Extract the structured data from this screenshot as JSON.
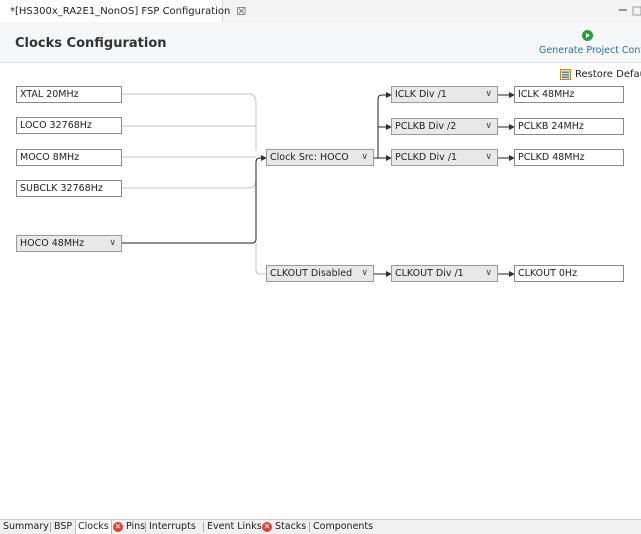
{
  "editor_tab": {
    "title": "*[HS300x_RA2E1_NonOS] FSP Configuration",
    "close": "☒"
  },
  "header": {
    "title": "Clocks Configuration",
    "generate_label": "Generate Project Content"
  },
  "toolbar": {
    "restore_label": "Restore Defaults"
  },
  "clock_sources": {
    "xtal": "XTAL 20MHz",
    "loco": "LOCO 32768Hz",
    "moco": "MOCO 8MHz",
    "subclk": "SUBCLK 32768Hz",
    "hoco": "HOCO 48MHz"
  },
  "clock_src_select": "Clock Src: HOCO",
  "dividers": {
    "iclk": "ICLK Div /1",
    "pclkb": "PCLKB Div /2",
    "pclkd": "PCLKD Div /1",
    "clkout_src": "CLKOUT Disabled",
    "clkout_div": "CLKOUT Div /1"
  },
  "outputs": {
    "iclk": "ICLK 48MHz",
    "pclkb": "PCLKB 24MHz",
    "pclkd": "PCLKD 48MHz",
    "clkout": "CLKOUT 0Hz"
  },
  "dropdown_glyph": "∨",
  "bottom_tabs": {
    "summary": "Summary",
    "bsp": "BSP",
    "clocks": "Clocks",
    "pins": "Pins",
    "interrupts": "Interrupts",
    "event_links": "Event Links",
    "stacks": "Stacks",
    "components": "Components"
  },
  "error_glyph": "✕"
}
